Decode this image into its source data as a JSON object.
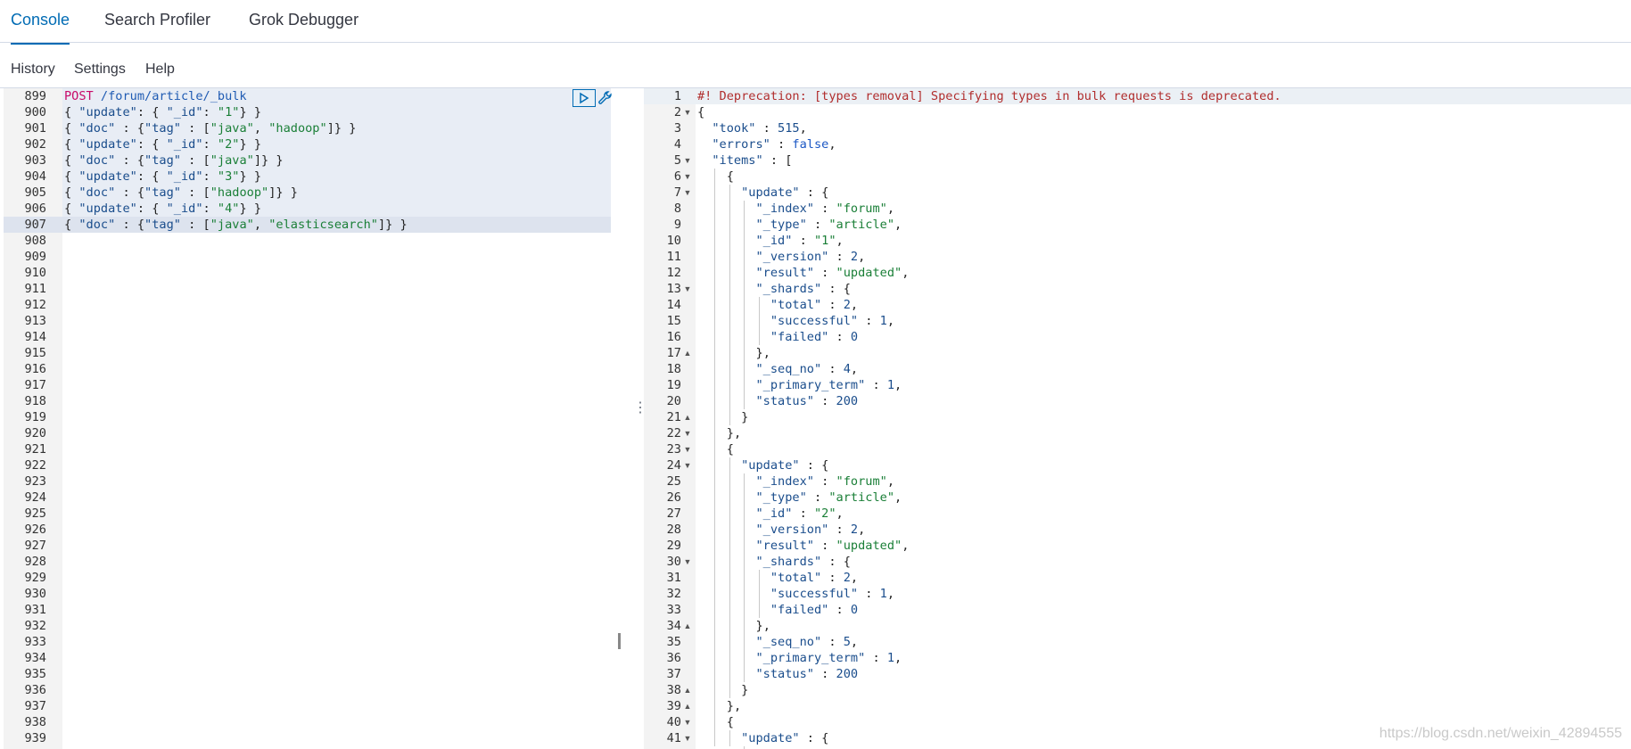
{
  "tabs": [
    {
      "label": "Console",
      "active": true
    },
    {
      "label": "Search Profiler",
      "active": false
    },
    {
      "label": "Grok Debugger",
      "active": false
    }
  ],
  "topnav": {
    "history": "History",
    "settings": "Settings",
    "help": "Help"
  },
  "left_editor": {
    "line_numbers": [
      "899",
      "900",
      "901",
      "902",
      "903",
      "904",
      "905",
      "906",
      "907",
      "908",
      "909",
      "910",
      "911",
      "912",
      "913",
      "914",
      "915",
      "916",
      "917",
      "918",
      "919",
      "920",
      "921",
      "922",
      "923",
      "924",
      "925",
      "926",
      "927",
      "928",
      "929",
      "930",
      "931",
      "932",
      "933",
      "934",
      "935",
      "936",
      "937",
      "938",
      "939"
    ],
    "request": {
      "method": "POST",
      "path": " /forum/article/_bulk",
      "body_lines": [
        "{ \"update\": { \"_id\": \"1\"} }",
        "{ \"doc\" : {\"tag\" : [\"java\", \"hadoop\"]} }",
        "{ \"update\": { \"_id\": \"2\"} }",
        "{ \"doc\" : {\"tag\" : [\"java\"]} }",
        "{ \"update\": { \"_id\": \"3\"} }",
        "{ \"doc\" : {\"tag\" : [\"hadoop\"]} }",
        "{ \"update\": { \"_id\": \"4\"} }",
        "{ \"doc\" : {\"tag\" : [\"java\", \"elasticsearch\"]} }"
      ]
    }
  },
  "right_editor": {
    "line_numbers": [
      "1",
      "2",
      "3",
      "4",
      "5",
      "6",
      "7",
      "8",
      "9",
      "10",
      "11",
      "12",
      "13",
      "14",
      "15",
      "16",
      "17",
      "18",
      "19",
      "20",
      "21",
      "22",
      "23",
      "24",
      "25",
      "26",
      "27",
      "28",
      "29",
      "30",
      "31",
      "32",
      "33",
      "34",
      "35",
      "36",
      "37",
      "38",
      "39",
      "40",
      "41"
    ],
    "lines": [
      "#! Deprecation: [types removal] Specifying types in bulk requests is deprecated.",
      "{",
      "  \"took\" : 515,",
      "  \"errors\" : false,",
      "  \"items\" : [",
      "    {",
      "      \"update\" : {",
      "        \"_index\" : \"forum\",",
      "        \"_type\" : \"article\",",
      "        \"_id\" : \"1\",",
      "        \"_version\" : 2,",
      "        \"result\" : \"updated\",",
      "        \"_shards\" : {",
      "          \"total\" : 2,",
      "          \"successful\" : 1,",
      "          \"failed\" : 0",
      "        },",
      "        \"_seq_no\" : 4,",
      "        \"_primary_term\" : 1,",
      "        \"status\" : 200",
      "      }",
      "    },",
      "    {",
      "      \"update\" : {",
      "        \"_index\" : \"forum\",",
      "        \"_type\" : \"article\",",
      "        \"_id\" : \"2\",",
      "        \"_version\" : 2,",
      "        \"result\" : \"updated\",",
      "        \"_shards\" : {",
      "          \"total\" : 2,",
      "          \"successful\" : 1,",
      "          \"failed\" : 0",
      "        },",
      "        \"_seq_no\" : 5,",
      "        \"_primary_term\" : 1,",
      "        \"status\" : 200",
      "      }",
      "    },",
      "    {",
      "      \"update\" : {"
    ],
    "fold_down": [
      2,
      5,
      6,
      7,
      13,
      22,
      23,
      24,
      30,
      40,
      41
    ],
    "fold_up": [
      17,
      21,
      34,
      38,
      39
    ]
  },
  "icons": {
    "run": "play-icon",
    "settings": "wrench-icon",
    "divider": "vertical-dots-icon"
  },
  "colors": {
    "accent": "#006bb4",
    "method": "#c80a68",
    "string": "#1a7f37",
    "key": "#1a4d8c",
    "comment": "#b12e2e"
  },
  "watermark": "https://blog.csdn.net/weixin_42894555"
}
